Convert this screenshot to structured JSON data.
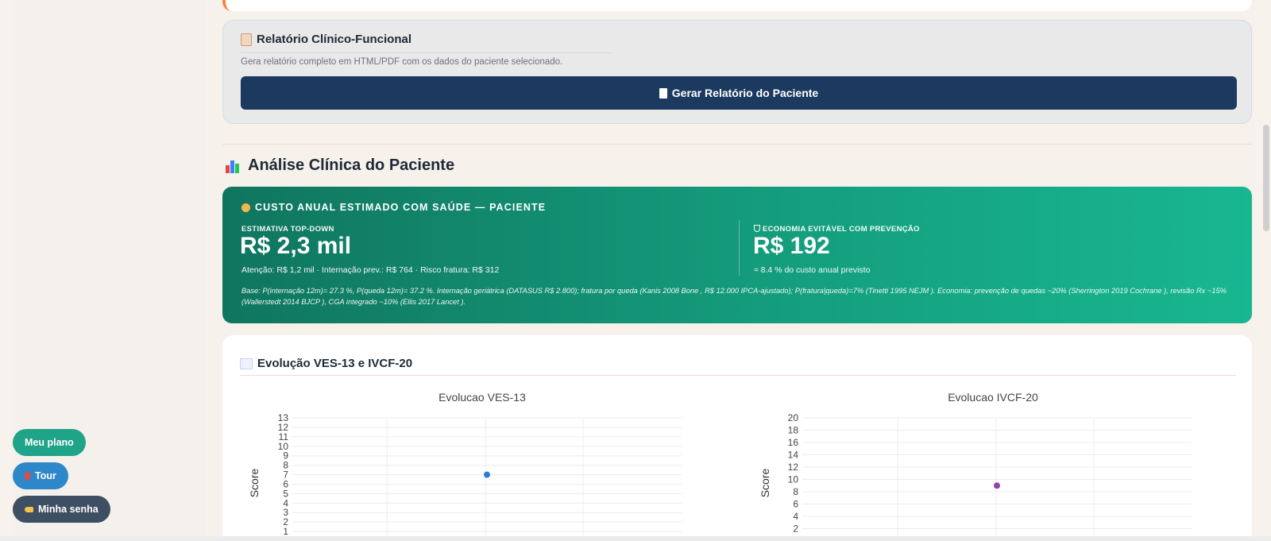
{
  "report": {
    "title": "Relatório Clínico-Funcional",
    "description": "Gera relatório completo em HTML/PDF com os dados do paciente selecionado.",
    "button_label": "Gerar Relatório do Paciente",
    "icon": "clipboard-icon"
  },
  "analysis": {
    "title": "Análise Clínica do Paciente",
    "icon": "bar-chart-icon"
  },
  "cost": {
    "header": "CUSTO ANUAL ESTIMADO COM SAÚDE — PACIENTE",
    "header_icon": "money-bag-icon",
    "left": {
      "label": "ESTIMATIVA TOP-DOWN",
      "value": "R$ 2,3 mil",
      "sub": "Atenção: R$ 1,2 mil · Internação prev.: R$ 764 · Risco fratura: R$ 312"
    },
    "right": {
      "label": "ECONOMIA EVITÁVEL COM PREVENÇÃO",
      "icon": "shield-icon",
      "value": "R$ 192",
      "sub": "≈ 8.4 % do custo anual previsto"
    },
    "base_text": "Base: P(internação 12m)= 27.3 %, P(queda 12m)= 37.2 %. Internação geriátrica (DATASUS R$ 2.800); fratura por queda (Kanis 2008 Bone , R$ 12.000 IPCA-ajustado); P(fratura|queda)=7% (Tinetti 1995 NEJM ). Economia: prevenção de quedas ~20% (Sherrington 2019 Cochrane ), revisão Rx ~15% (Wallerstedt 2014 BJCP ), CGA integrado ~10% (Ellis 2017 Lancet ).",
    "colors": {
      "gradient_start": "#10755f",
      "gradient_end": "#18b790"
    }
  },
  "evolution": {
    "title": "Evolução VES-13 e IVCF-20",
    "icon": "trend-chart-icon"
  },
  "chart_data": [
    {
      "type": "scatter",
      "title": "Evolucao VES-13",
      "ylabel": "Score",
      "ylim": [
        0,
        13
      ],
      "yticks": [
        1,
        2,
        3,
        4,
        5,
        6,
        7,
        8,
        9,
        10,
        11,
        12,
        13
      ],
      "grid": true,
      "series": [
        {
          "color": "#2b7bd9",
          "values": [
            7
          ]
        }
      ]
    },
    {
      "type": "scatter",
      "title": "Evolucao IVCF-20",
      "ylabel": "Score",
      "ylim": [
        0,
        20
      ],
      "yticks": [
        2,
        4,
        6,
        8,
        10,
        12,
        14,
        16,
        18,
        20
      ],
      "grid": true,
      "series": [
        {
          "color": "#8e44ad",
          "values": [
            9
          ]
        }
      ]
    }
  ],
  "floating_buttons": {
    "plan": "Meu plano",
    "tour": "Tour",
    "password": "Minha senha"
  }
}
